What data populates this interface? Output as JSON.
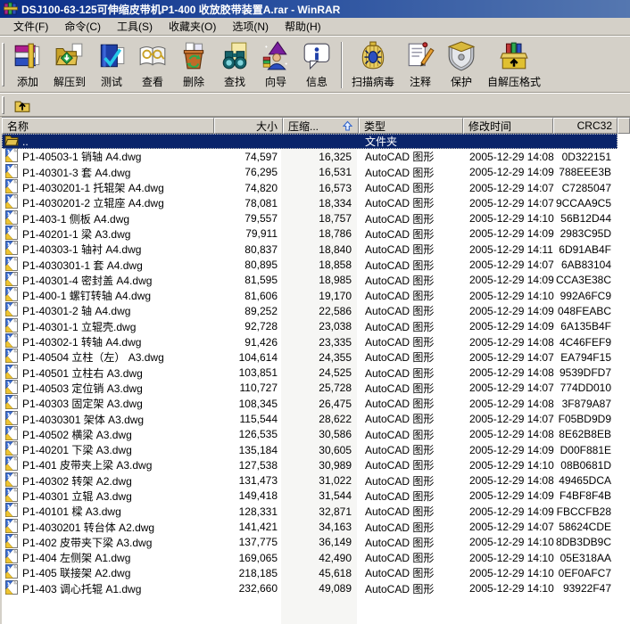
{
  "window": {
    "title": "DSJ100-63-125可伸缩皮带机P1-400 收放胶带装置A.rar - WinRAR",
    "app_icon": "winrar-books-icon"
  },
  "colors": {
    "titlebar_left": "#0b2d88",
    "titlebar_right": "#5577b0",
    "chrome": "#D4D0C8",
    "selection": "#0A246A",
    "sort_column_band": "#F6F6F4",
    "list_background": "#ffffff"
  },
  "menu": {
    "items": [
      {
        "label": "文件(F)"
      },
      {
        "label": "命令(C)"
      },
      {
        "label": "工具(S)"
      },
      {
        "label": "收藏夹(O)"
      },
      {
        "label": "选项(N)"
      },
      {
        "label": "帮助(H)"
      }
    ]
  },
  "toolbar": {
    "buttons": [
      {
        "label": "添加",
        "icon": "add-archive-icon"
      },
      {
        "label": "解压到",
        "icon": "extract-to-icon"
      },
      {
        "label": "测试",
        "icon": "test-archive-icon"
      },
      {
        "label": "查看",
        "icon": "view-file-icon"
      },
      {
        "label": "删除",
        "icon": "delete-icon"
      },
      {
        "label": "查找",
        "icon": "find-icon",
        "separator_after": false
      },
      {
        "label": "向导",
        "icon": "wizard-icon"
      },
      {
        "label": "信息",
        "icon": "info-icon",
        "separator_after": true
      },
      {
        "label": "扫描病毒",
        "icon": "virus-scan-icon"
      },
      {
        "label": "注释",
        "icon": "comment-icon"
      },
      {
        "label": "保护",
        "icon": "protect-icon"
      },
      {
        "label": "自解压格式",
        "icon": "sfx-icon"
      }
    ]
  },
  "addressbar": {
    "up_button_icon": "up-one-level-icon"
  },
  "list": {
    "columns": [
      {
        "label": "名称",
        "align": "left"
      },
      {
        "label": "大小",
        "align": "right"
      },
      {
        "label": "压缩...",
        "align": "left",
        "sorted": "asc"
      },
      {
        "label": "类型",
        "align": "left"
      },
      {
        "label": "修改时间",
        "align": "left"
      },
      {
        "label": "CRC32",
        "align": "right"
      }
    ],
    "parent_row": {
      "name": "..",
      "type": "文件夹",
      "icon": "folder-icon",
      "selected": true
    },
    "file_icon": "dwg-file-icon",
    "rows": [
      {
        "name": "P1-40503-1 销轴 A4.dwg",
        "size": "74,597",
        "packed": "16,325",
        "type": "AutoCAD 图形",
        "modified": "2005-12-29 14:08",
        "crc": "0D322151"
      },
      {
        "name": "P1-40301-3 套 A4.dwg",
        "size": "76,295",
        "packed": "16,531",
        "type": "AutoCAD 图形",
        "modified": "2005-12-29 14:09",
        "crc": "788EEE3B"
      },
      {
        "name": "P1-4030201-1 托辊架 A4.dwg",
        "size": "74,820",
        "packed": "16,573",
        "type": "AutoCAD 图形",
        "modified": "2005-12-29 14:07",
        "crc": "C7285047"
      },
      {
        "name": "P1-4030201-2 立辊座 A4.dwg",
        "size": "78,081",
        "packed": "18,334",
        "type": "AutoCAD 图形",
        "modified": "2005-12-29 14:07",
        "crc": "9CCAA9C5"
      },
      {
        "name": "P1-403-1 侧板 A4.dwg",
        "size": "79,557",
        "packed": "18,757",
        "type": "AutoCAD 图形",
        "modified": "2005-12-29 14:10",
        "crc": "56B12D44"
      },
      {
        "name": "P1-40201-1 梁 A3.dwg",
        "size": "79,911",
        "packed": "18,786",
        "type": "AutoCAD 图形",
        "modified": "2005-12-29 14:09",
        "crc": "2983C95D"
      },
      {
        "name": "P1-40303-1 轴衬 A4.dwg",
        "size": "80,837",
        "packed": "18,840",
        "type": "AutoCAD 图形",
        "modified": "2005-12-29 14:11",
        "crc": "6D91AB4F"
      },
      {
        "name": "P1-4030301-1 套 A4.dwg",
        "size": "80,895",
        "packed": "18,858",
        "type": "AutoCAD 图形",
        "modified": "2005-12-29 14:07",
        "crc": "6AB83104"
      },
      {
        "name": "P1-40301-4 密封盖 A4.dwg",
        "size": "81,595",
        "packed": "18,985",
        "type": "AutoCAD 图形",
        "modified": "2005-12-29 14:09",
        "crc": "CCA3E38C"
      },
      {
        "name": "P1-400-1 螺钉转轴 A4.dwg",
        "size": "81,606",
        "packed": "19,170",
        "type": "AutoCAD 图形",
        "modified": "2005-12-29 14:10",
        "crc": "992A6FC9"
      },
      {
        "name": "P1-40301-2 轴 A4.dwg",
        "size": "89,252",
        "packed": "22,586",
        "type": "AutoCAD 图形",
        "modified": "2005-12-29 14:09",
        "crc": "048FEABC"
      },
      {
        "name": "P1-40301-1 立辊壳.dwg",
        "size": "92,728",
        "packed": "23,038",
        "type": "AutoCAD 图形",
        "modified": "2005-12-29 14:09",
        "crc": "6A135B4F"
      },
      {
        "name": "P1-40302-1 转轴 A4.dwg",
        "size": "91,426",
        "packed": "23,335",
        "type": "AutoCAD 图形",
        "modified": "2005-12-29 14:08",
        "crc": "4C46FEF9"
      },
      {
        "name": "P1-40504 立柱（左） A3.dwg",
        "size": "104,614",
        "packed": "24,355",
        "type": "AutoCAD 图形",
        "modified": "2005-12-29 14:07",
        "crc": "EA794F15"
      },
      {
        "name": "P1-40501 立柱右 A3.dwg",
        "size": "103,851",
        "packed": "24,525",
        "type": "AutoCAD 图形",
        "modified": "2005-12-29 14:08",
        "crc": "9539DFD7"
      },
      {
        "name": "P1-40503 定位销 A3.dwg",
        "size": "110,727",
        "packed": "25,728",
        "type": "AutoCAD 图形",
        "modified": "2005-12-29 14:07",
        "crc": "774DD010"
      },
      {
        "name": "P1-40303 固定架 A3.dwg",
        "size": "108,345",
        "packed": "26,475",
        "type": "AutoCAD 图形",
        "modified": "2005-12-29 14:08",
        "crc": "3F879A87"
      },
      {
        "name": "P1-4030301 架体 A3.dwg",
        "size": "115,544",
        "packed": "28,622",
        "type": "AutoCAD 图形",
        "modified": "2005-12-29 14:07",
        "crc": "F05BD9D9"
      },
      {
        "name": "P1-40502 横梁 A3.dwg",
        "size": "126,535",
        "packed": "30,586",
        "type": "AutoCAD 图形",
        "modified": "2005-12-29 14:08",
        "crc": "8E62B8EB"
      },
      {
        "name": "P1-40201 下梁 A3.dwg",
        "size": "135,184",
        "packed": "30,605",
        "type": "AutoCAD 图形",
        "modified": "2005-12-29 14:09",
        "crc": "D00F881E"
      },
      {
        "name": "P1-401 皮带夹上梁 A3.dwg",
        "size": "127,538",
        "packed": "30,989",
        "type": "AutoCAD 图形",
        "modified": "2005-12-29 14:10",
        "crc": "08B0681D"
      },
      {
        "name": "P1-40302 转架 A2.dwg",
        "size": "131,473",
        "packed": "31,022",
        "type": "AutoCAD 图形",
        "modified": "2005-12-29 14:08",
        "crc": "49465DCA"
      },
      {
        "name": "P1-40301 立辊 A3.dwg",
        "size": "149,418",
        "packed": "31,544",
        "type": "AutoCAD 图形",
        "modified": "2005-12-29 14:09",
        "crc": "F4BF8F4B"
      },
      {
        "name": "P1-40101 樑 A3.dwg",
        "size": "128,331",
        "packed": "32,871",
        "type": "AutoCAD 图形",
        "modified": "2005-12-29 14:09",
        "crc": "FBCCFB28"
      },
      {
        "name": "P1-4030201 转台体 A2.dwg",
        "size": "141,421",
        "packed": "34,163",
        "type": "AutoCAD 图形",
        "modified": "2005-12-29 14:07",
        "crc": "58624CDE"
      },
      {
        "name": "P1-402 皮带夹下梁 A3.dwg",
        "size": "137,775",
        "packed": "36,149",
        "type": "AutoCAD 图形",
        "modified": "2005-12-29 14:10",
        "crc": "8DB3DB9C"
      },
      {
        "name": "P1-404 左侧架 A1.dwg",
        "size": "169,065",
        "packed": "42,490",
        "type": "AutoCAD 图形",
        "modified": "2005-12-29 14:10",
        "crc": "05E318AA"
      },
      {
        "name": "P1-405 联接架 A2.dwg",
        "size": "218,185",
        "packed": "45,618",
        "type": "AutoCAD 图形",
        "modified": "2005-12-29 14:10",
        "crc": "0EF0AFC7"
      },
      {
        "name": "P1-403 调心托辊 A1.dwg",
        "size": "232,660",
        "packed": "49,089",
        "type": "AutoCAD 图形",
        "modified": "2005-12-29 14:10",
        "crc": "93922F47"
      }
    ]
  }
}
